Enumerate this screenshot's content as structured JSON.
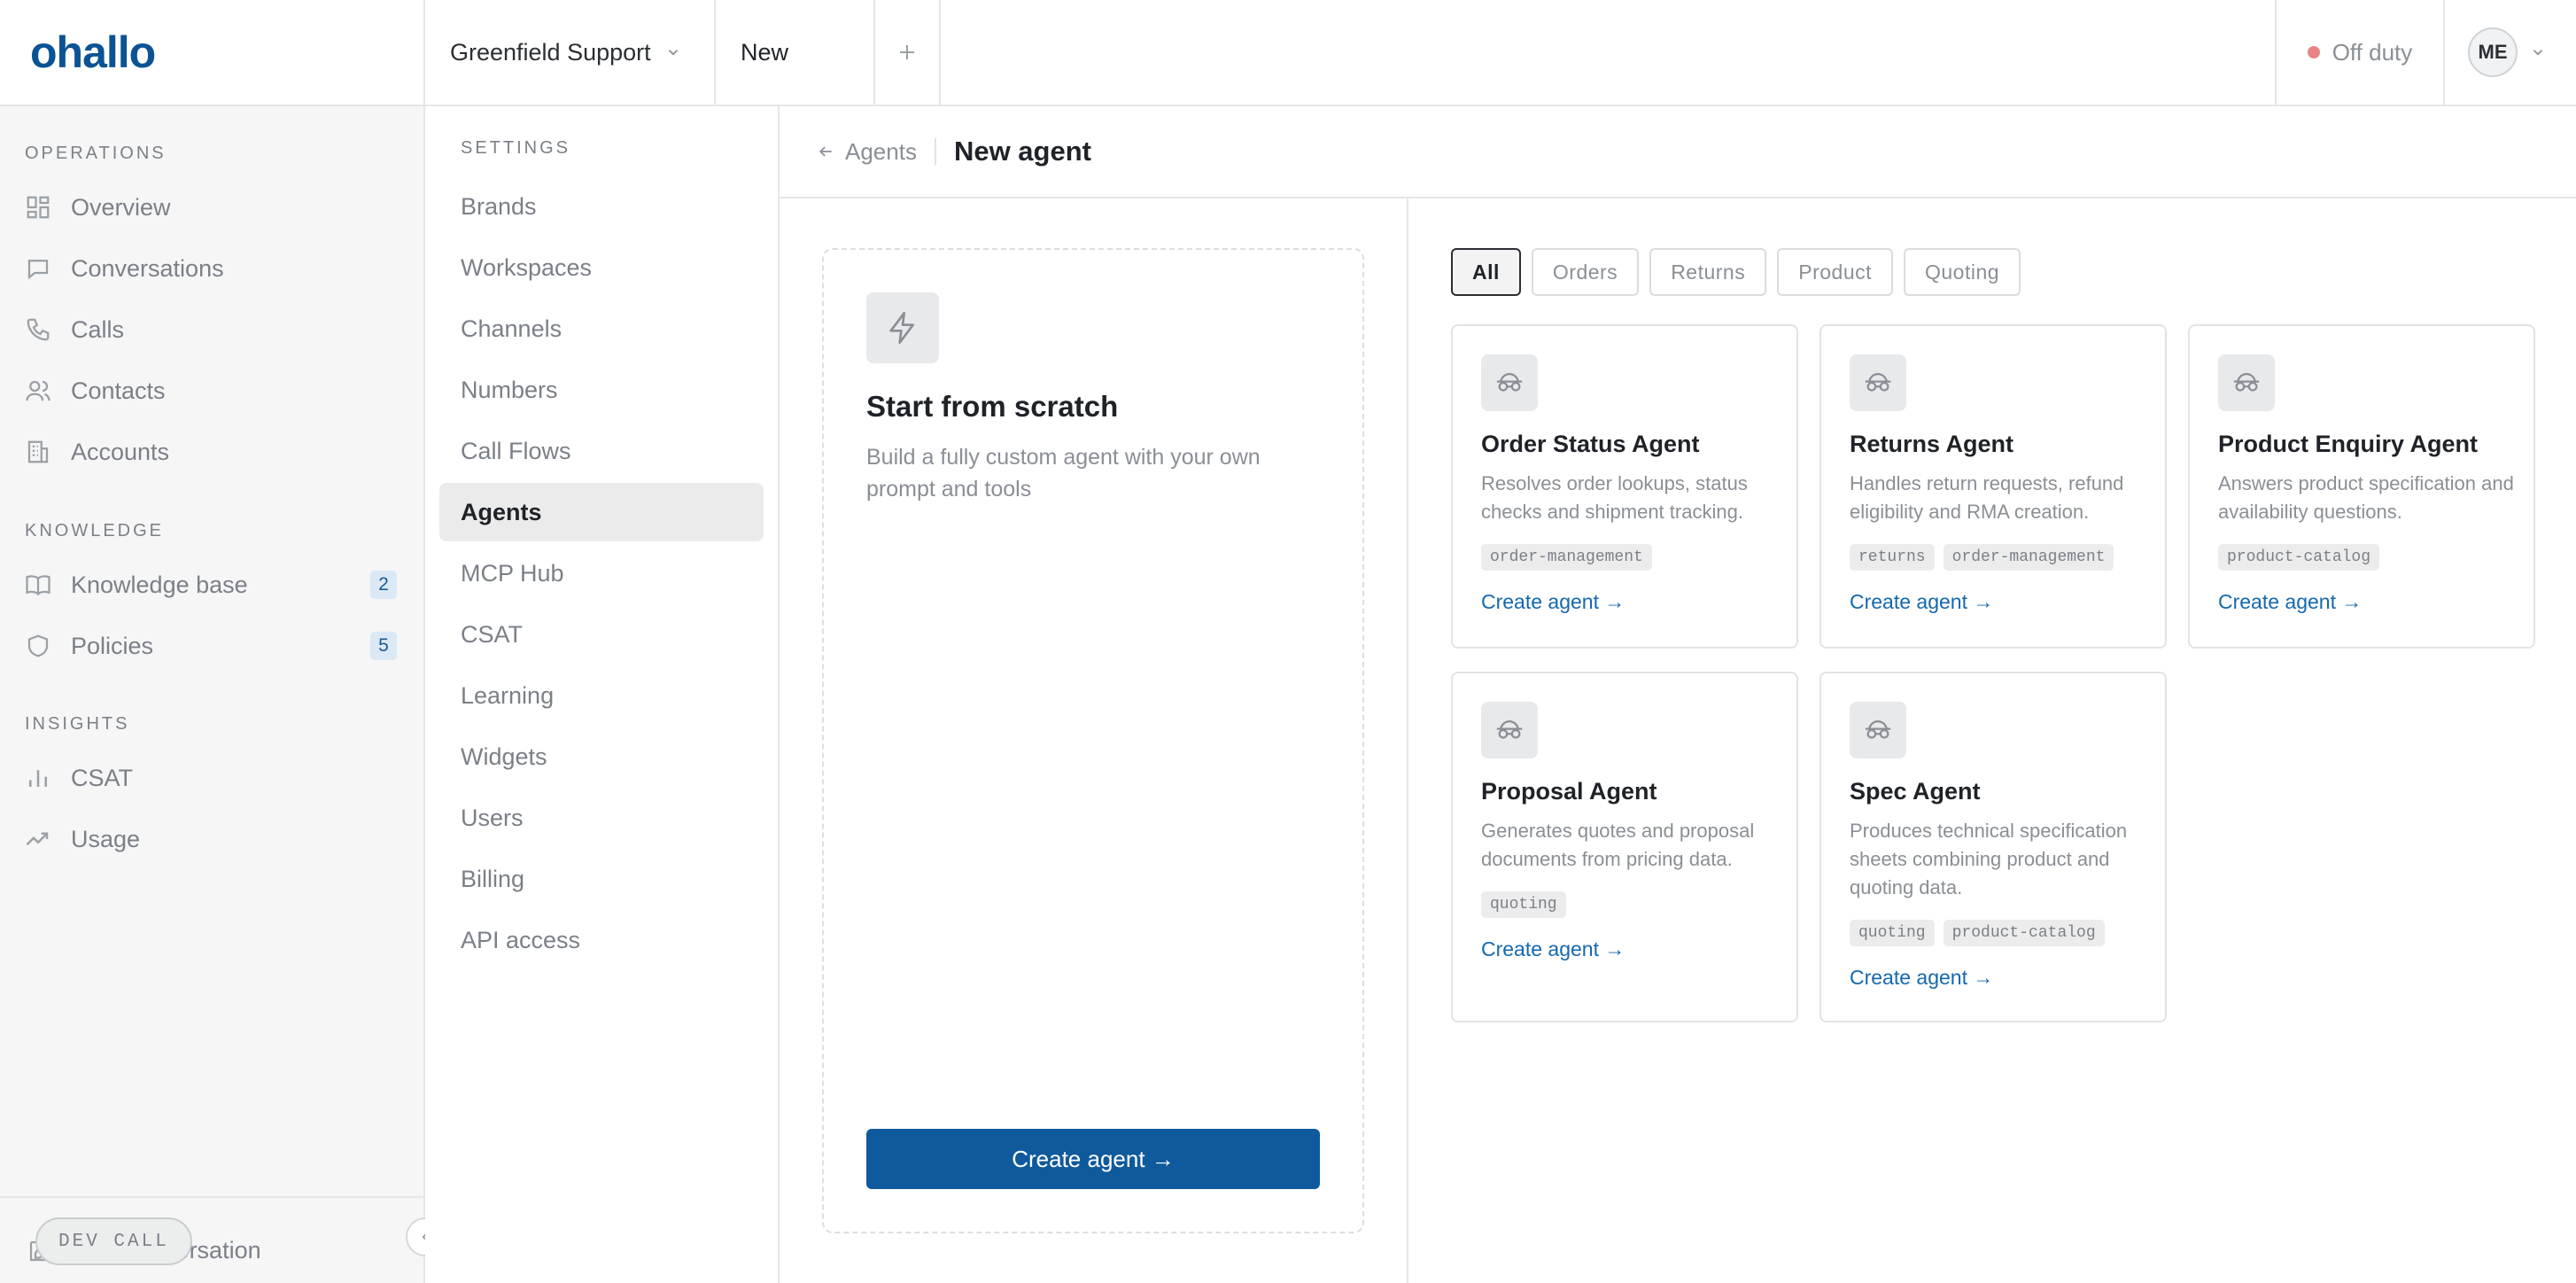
{
  "brand": {
    "logo_text": "ohallo",
    "accent": "#0f5a9c"
  },
  "topbar": {
    "workspace": "Greenfield Support",
    "tab_active": "New",
    "status": "Off duty",
    "status_color": "#e88484",
    "user_initials": "ME"
  },
  "nav": {
    "sections": [
      {
        "title": "OPERATIONS",
        "items": [
          {
            "label": "Overview",
            "icon": "dashboard-icon"
          },
          {
            "label": "Conversations",
            "icon": "chat-bubble-icon"
          },
          {
            "label": "Calls",
            "icon": "phone-icon"
          },
          {
            "label": "Contacts",
            "icon": "users-icon"
          },
          {
            "label": "Accounts",
            "icon": "building-icon"
          }
        ]
      },
      {
        "title": "KNOWLEDGE",
        "items": [
          {
            "label": "Knowledge base",
            "icon": "book-icon",
            "badge": "2"
          },
          {
            "label": "Policies",
            "icon": "shield-icon",
            "badge": "5"
          }
        ]
      },
      {
        "title": "INSIGHTS",
        "items": [
          {
            "label": "CSAT",
            "icon": "bar-chart-icon"
          },
          {
            "label": "Usage",
            "icon": "trend-icon"
          }
        ]
      }
    ],
    "footer_label": "New conversation",
    "dev_call": "DEV CALL"
  },
  "settings": {
    "title": "SETTINGS",
    "items": [
      "Brands",
      "Workspaces",
      "Channels",
      "Numbers",
      "Call Flows",
      "Agents",
      "MCP Hub",
      "CSAT",
      "Learning",
      "Widgets",
      "Users",
      "Billing",
      "API access"
    ],
    "active": "Agents"
  },
  "main": {
    "back_label": "Agents",
    "title": "New agent",
    "scratch": {
      "title": "Start from scratch",
      "description": "Build a fully custom agent with your own prompt and tools",
      "button": "Create agent →"
    },
    "filters": [
      "All",
      "Orders",
      "Returns",
      "Product",
      "Quoting"
    ],
    "active_filter": "All",
    "templates": [
      {
        "title": "Order Status Agent",
        "description": "Resolves order lookups, status checks and shipment tracking.",
        "tags": [
          "order-management"
        ],
        "link": "Create agent →"
      },
      {
        "title": "Returns Agent",
        "description": "Handles return requests, refund eligibility and RMA creation.",
        "tags": [
          "returns",
          "order-management"
        ],
        "link": "Create agent →"
      },
      {
        "title": "Product Enquiry Agent",
        "description": "Answers product specification and availability questions.",
        "tags": [
          "product-catalog"
        ],
        "link": "Create agent →"
      },
      {
        "title": "Proposal Agent",
        "description": "Generates quotes and proposal documents from pricing data.",
        "tags": [
          "quoting"
        ],
        "link": "Create agent →"
      },
      {
        "title": "Spec Agent",
        "description": "Produces technical specification sheets combining product and quoting data.",
        "tags": [
          "quoting",
          "product-catalog"
        ],
        "link": "Create agent →"
      }
    ]
  }
}
